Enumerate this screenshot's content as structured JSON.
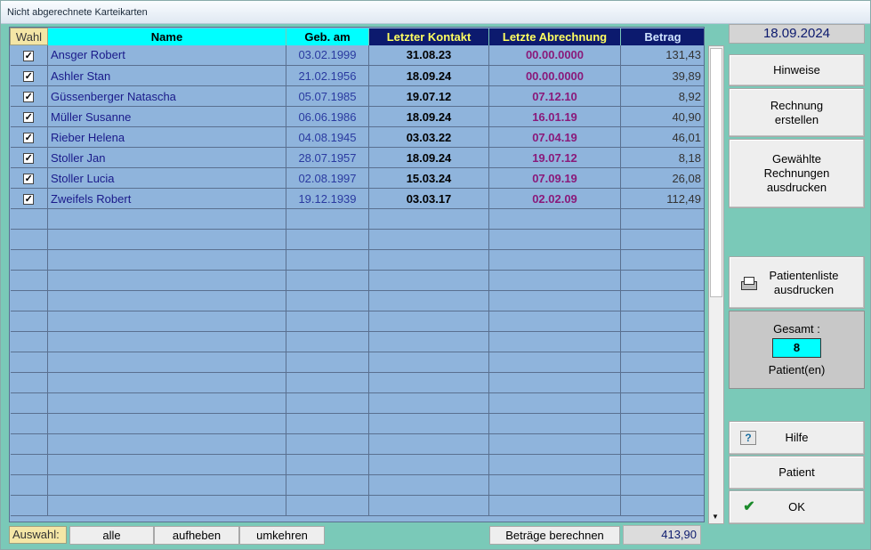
{
  "window": {
    "title": "Nicht abgerechnete Karteikarten"
  },
  "table": {
    "headers": {
      "wahl": "Wahl",
      "name": "Name",
      "geb": "Geb. am",
      "kontakt": "Letzter Kontakt",
      "abrechnung": "Letzte Abrechnung",
      "betrag": "Betrag"
    },
    "rows": [
      {
        "name": "Ansger Robert",
        "geb": "03.02.1999",
        "kontakt": "31.08.23",
        "abrechnung": "00.00.0000",
        "betrag": "131,43",
        "checked": "✓"
      },
      {
        "name": "Ashler Stan",
        "geb": "21.02.1956",
        "kontakt": "18.09.24",
        "abrechnung": "00.00.0000",
        "betrag": "39,89",
        "checked": "✓"
      },
      {
        "name": "Güssenberger Natascha",
        "geb": "05.07.1985",
        "kontakt": "19.07.12",
        "abrechnung": "07.12.10",
        "betrag": "8,92",
        "checked": "✓"
      },
      {
        "name": "Müller Susanne",
        "geb": "06.06.1986",
        "kontakt": "18.09.24",
        "abrechnung": "16.01.19",
        "betrag": "40,90",
        "checked": "✓"
      },
      {
        "name": "Rieber Helena",
        "geb": "04.08.1945",
        "kontakt": "03.03.22",
        "abrechnung": "07.04.19",
        "betrag": "46,01",
        "checked": "✓"
      },
      {
        "name": "Stoller Jan",
        "geb": "28.07.1957",
        "kontakt": "18.09.24",
        "abrechnung": "19.07.12",
        "betrag": "8,18",
        "checked": "✓"
      },
      {
        "name": "Stoller Lucia",
        "geb": "02.08.1997",
        "kontakt": "15.03.24",
        "abrechnung": "07.09.19",
        "betrag": "26,08",
        "checked": "✓"
      },
      {
        "name": "Zweifels Robert",
        "geb": "19.12.1939",
        "kontakt": "03.03.17",
        "abrechnung": "02.02.09",
        "betrag": "112,49",
        "checked": "✓"
      }
    ],
    "empty_row_count": 15
  },
  "sidebar": {
    "date": "18.09.2024",
    "hinweise": "Hinweise",
    "rechnung_erstellen": "Rechnung erstellen",
    "rechnungen_ausdrucken": "Gewählte Rechnungen ausdrucken",
    "patientenliste": "Patientenliste ausdrucken",
    "gesamt_label": "Gesamt :",
    "gesamt_count": "8",
    "patienten_label": "Patient(en)",
    "hilfe": "Hilfe",
    "patient": "Patient",
    "ok": "OK"
  },
  "bottom": {
    "auswahl": "Auswahl:",
    "alle": "alle",
    "aufheben": "aufheben",
    "umkehren": "umkehren",
    "betraege_berechnen": "Beträge berechnen",
    "summe": "413,90"
  },
  "icons": {
    "print": "printer-icon",
    "help": "help-icon",
    "ok": "checkmark-icon"
  }
}
